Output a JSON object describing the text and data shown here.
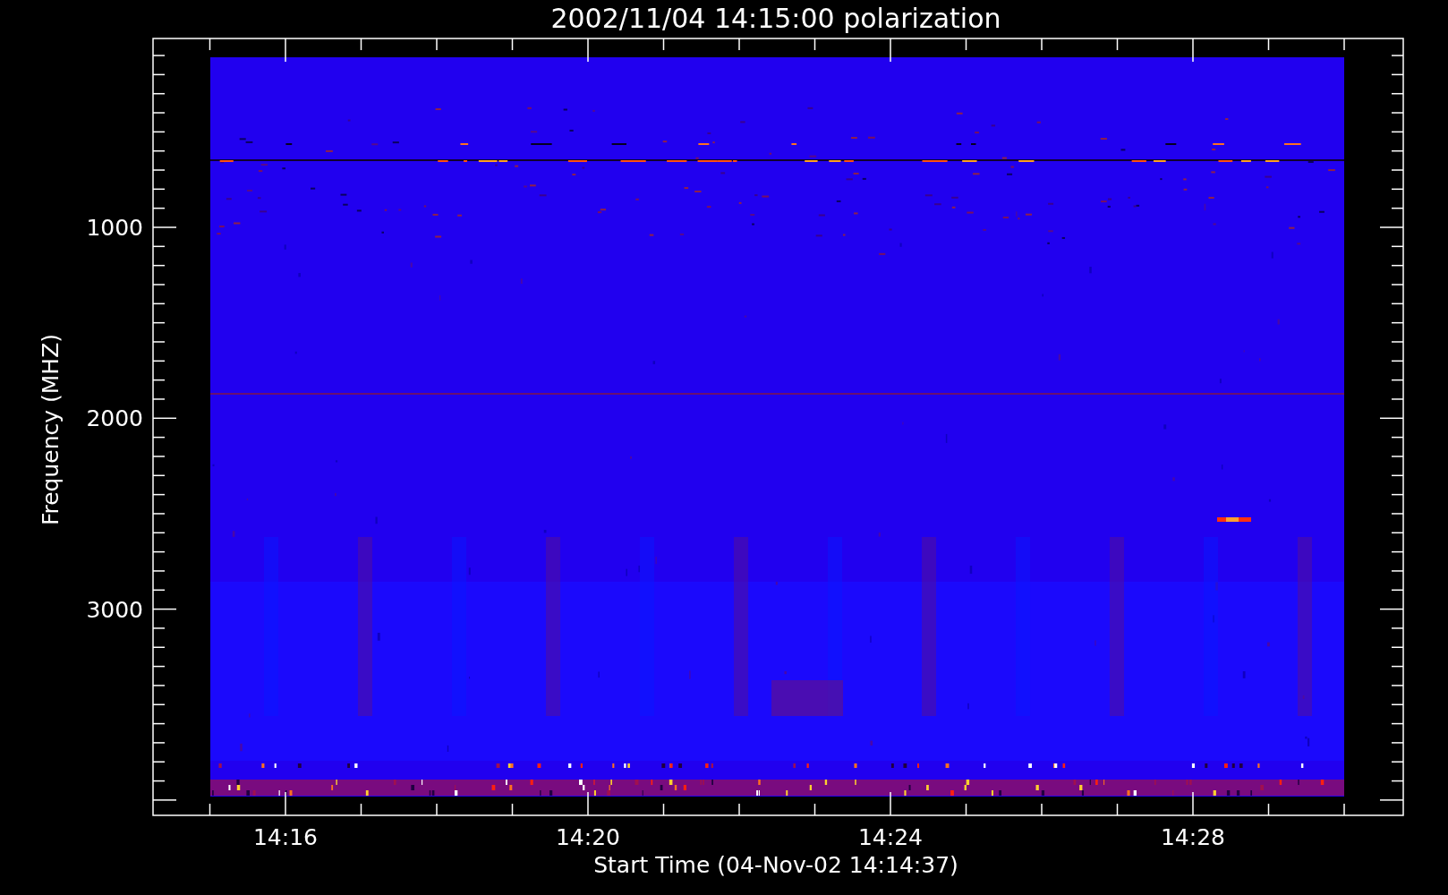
{
  "title": "2002/11/04 14:15:00 polarization",
  "xlabel": "Start Time (04-Nov-02 14:14:37)",
  "ylabel": "Frequency (MHZ)",
  "xticks": [
    "14:16",
    "14:20",
    "14:24",
    "14:28"
  ],
  "yticks": [
    "1000",
    "2000",
    "3000"
  ]
}
